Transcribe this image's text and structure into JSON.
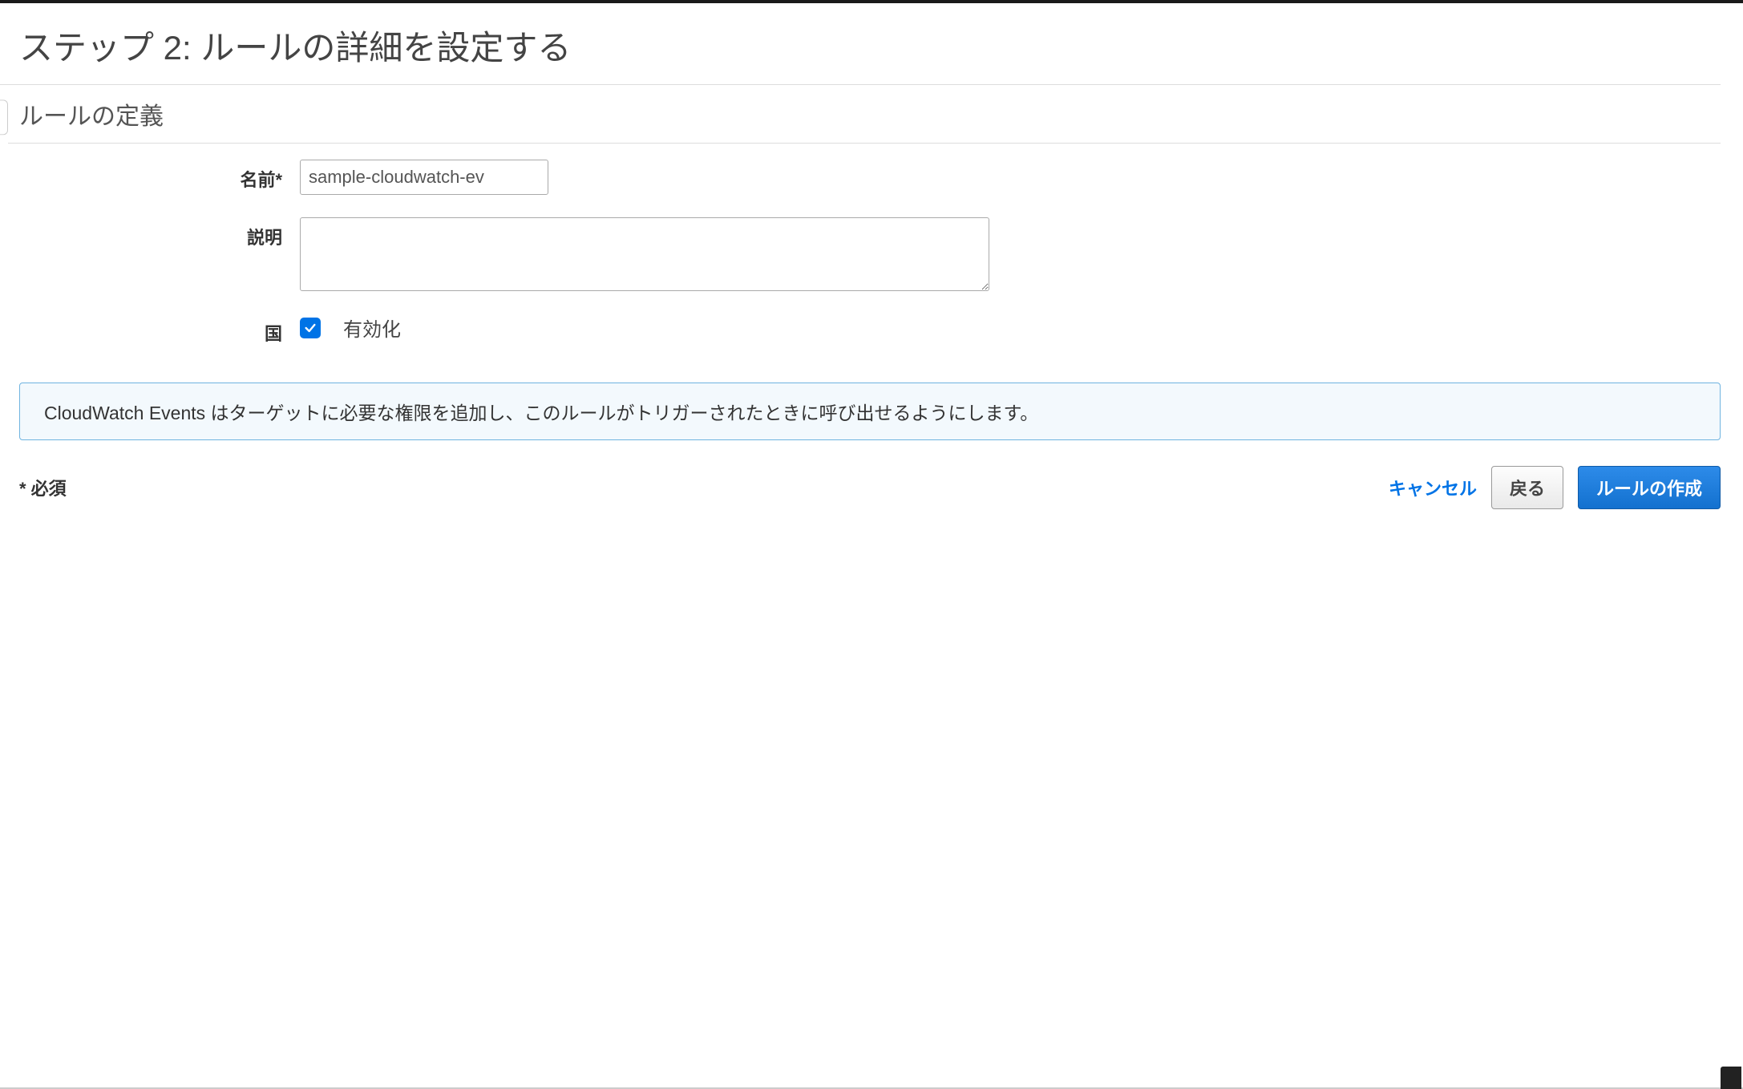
{
  "header": {
    "title": "ステップ 2: ルールの詳細を設定する",
    "section_title": "ルールの定義"
  },
  "form": {
    "name": {
      "label": "名前*",
      "value": "sample-cloudwatch-ev"
    },
    "description": {
      "label": "説明",
      "value": ""
    },
    "state": {
      "label": "国",
      "checked": true,
      "enabled_text": "有効化"
    }
  },
  "info_banner": "CloudWatch Events はターゲットに必要な権限を追加し、このルールがトリガーされたときに呼び出せるようにします。",
  "footer": {
    "required_note": "* 必須",
    "cancel": "キャンセル",
    "back": "戻る",
    "create": "ルールの作成"
  }
}
